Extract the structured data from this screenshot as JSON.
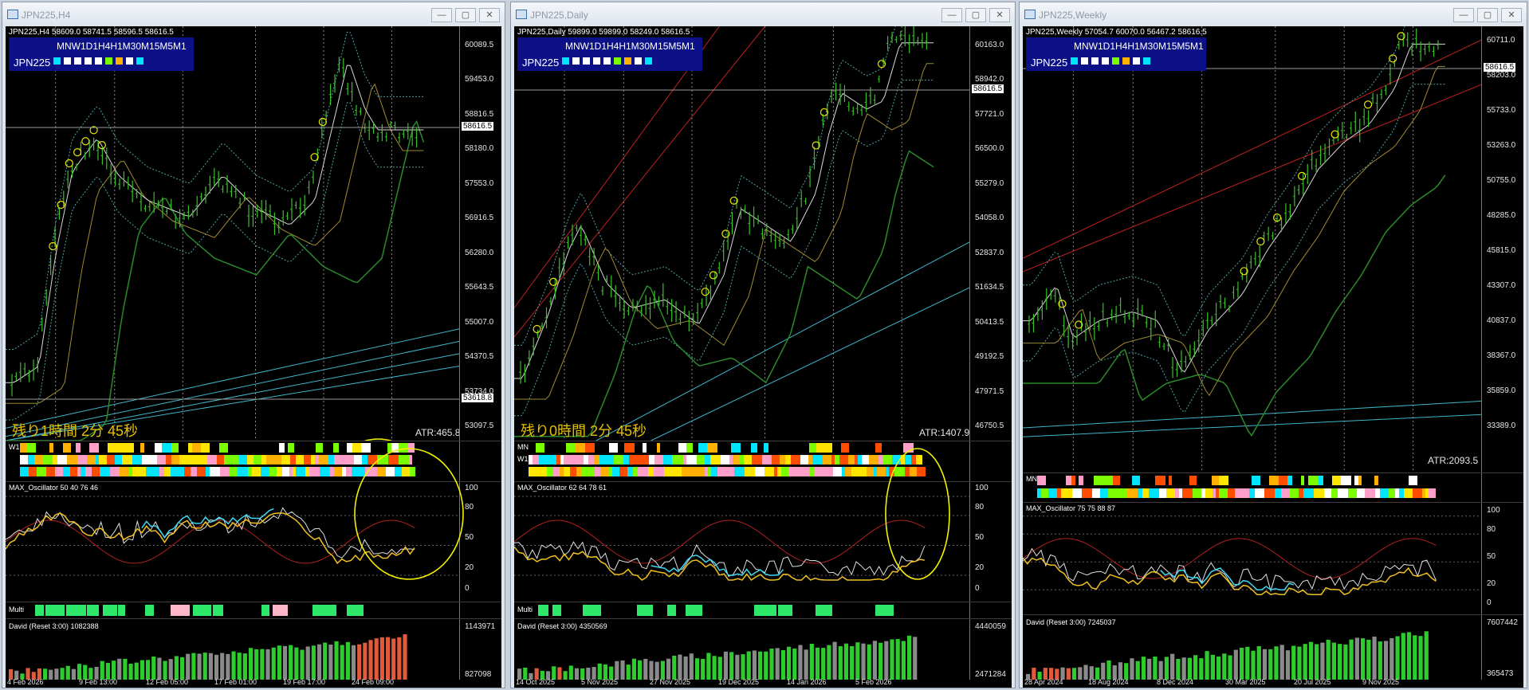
{
  "windows": [
    {
      "title": "JPN225,H4",
      "symbol_line": "JPN225,H4  58609.0 58741.5 58596.5 58616.5",
      "panel_tf": "MNW1D1H4H1M30M15M5M1",
      "panel_symbol": "JPN225",
      "panel_colors": [
        "#00e5ff",
        "#ffffff",
        "#ffffff",
        "#ffffff",
        "#ffffff",
        "#7cfc00",
        "#ffb000",
        "#ffffff",
        "#00e5ff"
      ],
      "price_axis": [
        "60089.5",
        "59453.0",
        "58816.5",
        "58180.0",
        "57553.0",
        "56916.5",
        "56280.0",
        "55643.5",
        "55007.0",
        "54370.5",
        "53734.0",
        "53097.5"
      ],
      "current_price": "58616.5",
      "second_price_tag": "53618.8",
      "timer": "残り1時間 2分 45秒",
      "atr": "ATR:465.8",
      "bar_label_1": "W1",
      "bar_label_2": "",
      "oscillator_label": "MAX_Oscillator 50 40 76 46",
      "osc_axis": [
        "100",
        "80",
        "50",
        "20",
        "0"
      ],
      "multi_label": "Multi",
      "david_label": "David (Reset 3:00) 1082388",
      "david_axis": [
        "1143971",
        "827098"
      ],
      "x_axis": [
        "4 Feb 2026",
        "9 Feb 13:00",
        "12 Feb 05:00",
        "17 Feb 01:00",
        "19 Feb 17:00",
        "24 Feb 09:00"
      ]
    },
    {
      "title": "JPN225,Daily",
      "symbol_line": "JPN225,Daily  59899.0 59899.0 58249.0 58616.5",
      "panel_tf": "MNW1D1H4H1M30M15M5M1",
      "panel_symbol": "JPN225",
      "panel_colors": [
        "#00e5ff",
        "#ffffff",
        "#ffffff",
        "#ffffff",
        "#ffffff",
        "#7cfc00",
        "#ffb000",
        "#ffffff",
        "#00e5ff"
      ],
      "price_axis": [
        "60163.0",
        "58942.0",
        "57721.0",
        "56500.0",
        "55279.0",
        "54058.0",
        "52837.0",
        "51634.5",
        "50413.5",
        "49192.5",
        "47971.5",
        "46750.5"
      ],
      "current_price": "58616.5",
      "timer": "残り0時間 2分 45秒",
      "atr": "ATR:1407.9",
      "bar_label_1": "MN",
      "bar_label_2": "W1",
      "oscillator_label": "MAX_Oscillator 62 64 78 61",
      "osc_axis": [
        "100",
        "80",
        "50",
        "20",
        "0"
      ],
      "multi_label": "Multi",
      "david_label": "David (Reset 3:00) 4350569",
      "david_axis": [
        "4440059",
        "2471284"
      ],
      "x_axis": [
        "14 Oct 2025",
        "5 Nov 2025",
        "27 Nov 2025",
        "19 Dec 2025",
        "14 Jan 2026",
        "5 Feb 2026"
      ]
    },
    {
      "title": "JPN225,Weekly",
      "symbol_line": "JPN225,Weekly  57054.7 60070.0 56467.2 58616.5",
      "panel_tf": "MNW1D1H4H1M30M15M5M1",
      "panel_symbol": "JPN225",
      "panel_colors": [
        "#00e5ff",
        "#ffffff",
        "#ffffff",
        "#ffffff",
        "#7cfc00",
        "#ffb000",
        "#ffffff",
        "#00e5ff"
      ],
      "price_axis": [
        "60711.0",
        "58203.0",
        "55733.0",
        "53263.0",
        "50755.0",
        "48285.0",
        "45815.0",
        "43307.0",
        "40837.0",
        "38367.0",
        "35859.0",
        "33389.0"
      ],
      "current_price": "58616.5",
      "timer": "",
      "atr": "ATR:2093.5",
      "bar_label_1": "MN",
      "bar_label_2": "",
      "oscillator_label": "MAX_Oscillator 75 75 88 87",
      "osc_axis": [
        "100",
        "80",
        "50",
        "20",
        "0"
      ],
      "multi_label": "",
      "david_label": "David (Reset 3:00) 7245037",
      "david_axis": [
        "7607442",
        "365473"
      ],
      "x_axis": [
        "28 Apr 2024",
        "18 Aug 2024",
        "8 Dec 2024",
        "30 Mar 2025",
        "20 Jul 2025",
        "9 Nov 2025"
      ]
    }
  ]
}
